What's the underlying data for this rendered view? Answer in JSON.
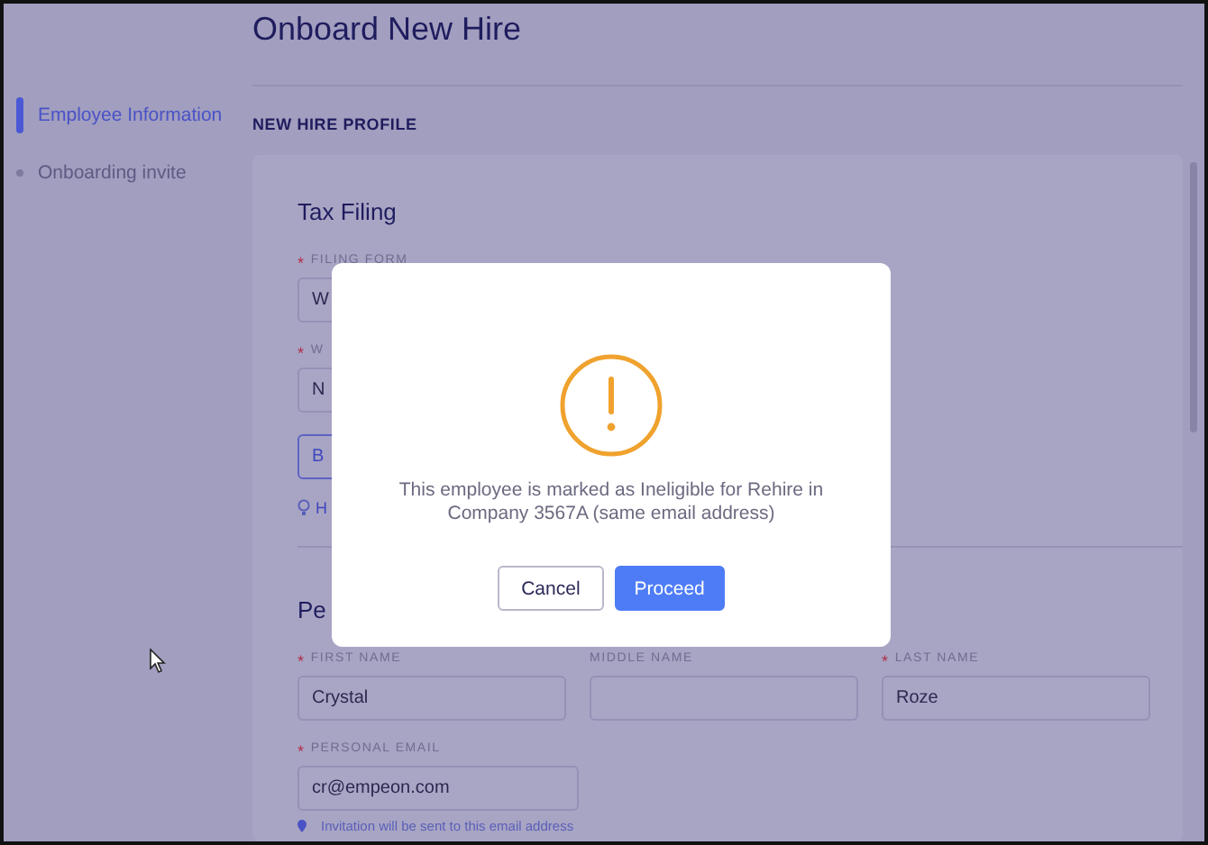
{
  "page": {
    "title": "Onboard New Hire",
    "section": "NEW HIRE PROFILE"
  },
  "required_marker": "*",
  "sidebar": {
    "items": [
      {
        "label": "Employee Information",
        "selected": true
      },
      {
        "label": "Onboarding invite",
        "selected": false
      }
    ]
  },
  "tax_filing": {
    "heading": "Tax Filing",
    "fields": [
      {
        "label": "FILING FORM",
        "required": true,
        "value": "W"
      },
      {
        "label": "W",
        "required": true,
        "value": "N"
      }
    ],
    "button": "B",
    "hint": "H"
  },
  "personal": {
    "heading": "Pe",
    "name_fields": [
      {
        "label": "FIRST NAME",
        "required": true,
        "value": "Crystal"
      },
      {
        "label": "MIDDLE NAME",
        "required": false
      },
      {
        "label": "LAST NAME",
        "required": true,
        "value": "Roze"
      }
    ],
    "email": {
      "label": "PERSONAL EMAIL",
      "required": true,
      "value": "cr@empeon.com"
    },
    "email_note": "Invitation will be sent to this email address"
  },
  "dialog": {
    "message_lines": [
      "This employee is marked as Ineligible for Rehire in",
      "Company 3567A (same email address)"
    ],
    "buttons": [
      {
        "label": "Cancel",
        "kind": "secondary"
      },
      {
        "label": "Proceed",
        "kind": "primary"
      }
    ]
  }
}
